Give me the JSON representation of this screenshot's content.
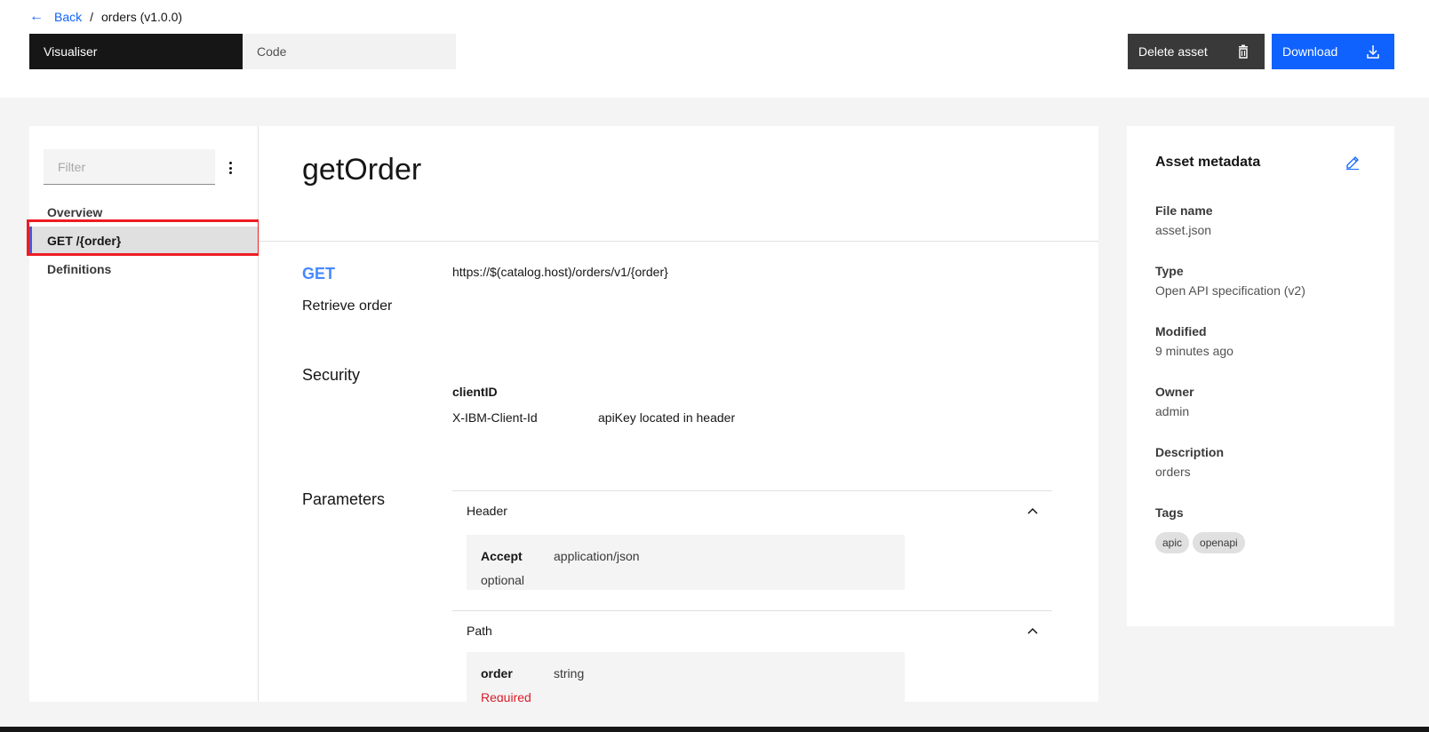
{
  "breadcrumb": {
    "back_label": "Back",
    "separator": "/",
    "current": "orders (v1.0.0)"
  },
  "view_switcher": {
    "visualiser": "Visualiser",
    "code": "Code"
  },
  "actions": {
    "delete_label": "Delete asset",
    "download_label": "Download"
  },
  "sidebar": {
    "filter_placeholder": "Filter",
    "items": [
      {
        "label": "Overview",
        "selected": false
      },
      {
        "label": "GET /{order}",
        "selected": true
      },
      {
        "label": "Definitions",
        "selected": false
      }
    ]
  },
  "operation": {
    "title": "getOrder",
    "method": "GET",
    "url": "https://$(catalog.host)/orders/v1/{order}",
    "summary": "Retrieve order",
    "security_label": "Security",
    "security": {
      "name": "clientID",
      "key": "X-IBM-Client-Id",
      "description": "apiKey located in header"
    },
    "parameters_label": "Parameters",
    "groups": [
      {
        "label": "Header",
        "param": {
          "name": "Accept",
          "type": "application/json",
          "note": "optional"
        }
      },
      {
        "label": "Path",
        "param": {
          "name": "order",
          "type": "string",
          "note": "Required"
        }
      }
    ]
  },
  "metadata": {
    "title": "Asset metadata",
    "fields": [
      {
        "label": "File name",
        "value": "asset.json"
      },
      {
        "label": "Type",
        "value": "Open API specification (v2)"
      },
      {
        "label": "Modified",
        "value": "9 minutes ago"
      },
      {
        "label": "Owner",
        "value": "admin"
      },
      {
        "label": "Description",
        "value": "orders"
      }
    ],
    "tags_label": "Tags",
    "tags": [
      "apic",
      "openapi"
    ]
  },
  "colors": {
    "primary": "#0f62fe",
    "method_get": "#4589ff",
    "required": "#da1e28",
    "highlight": "#ee1d23"
  }
}
